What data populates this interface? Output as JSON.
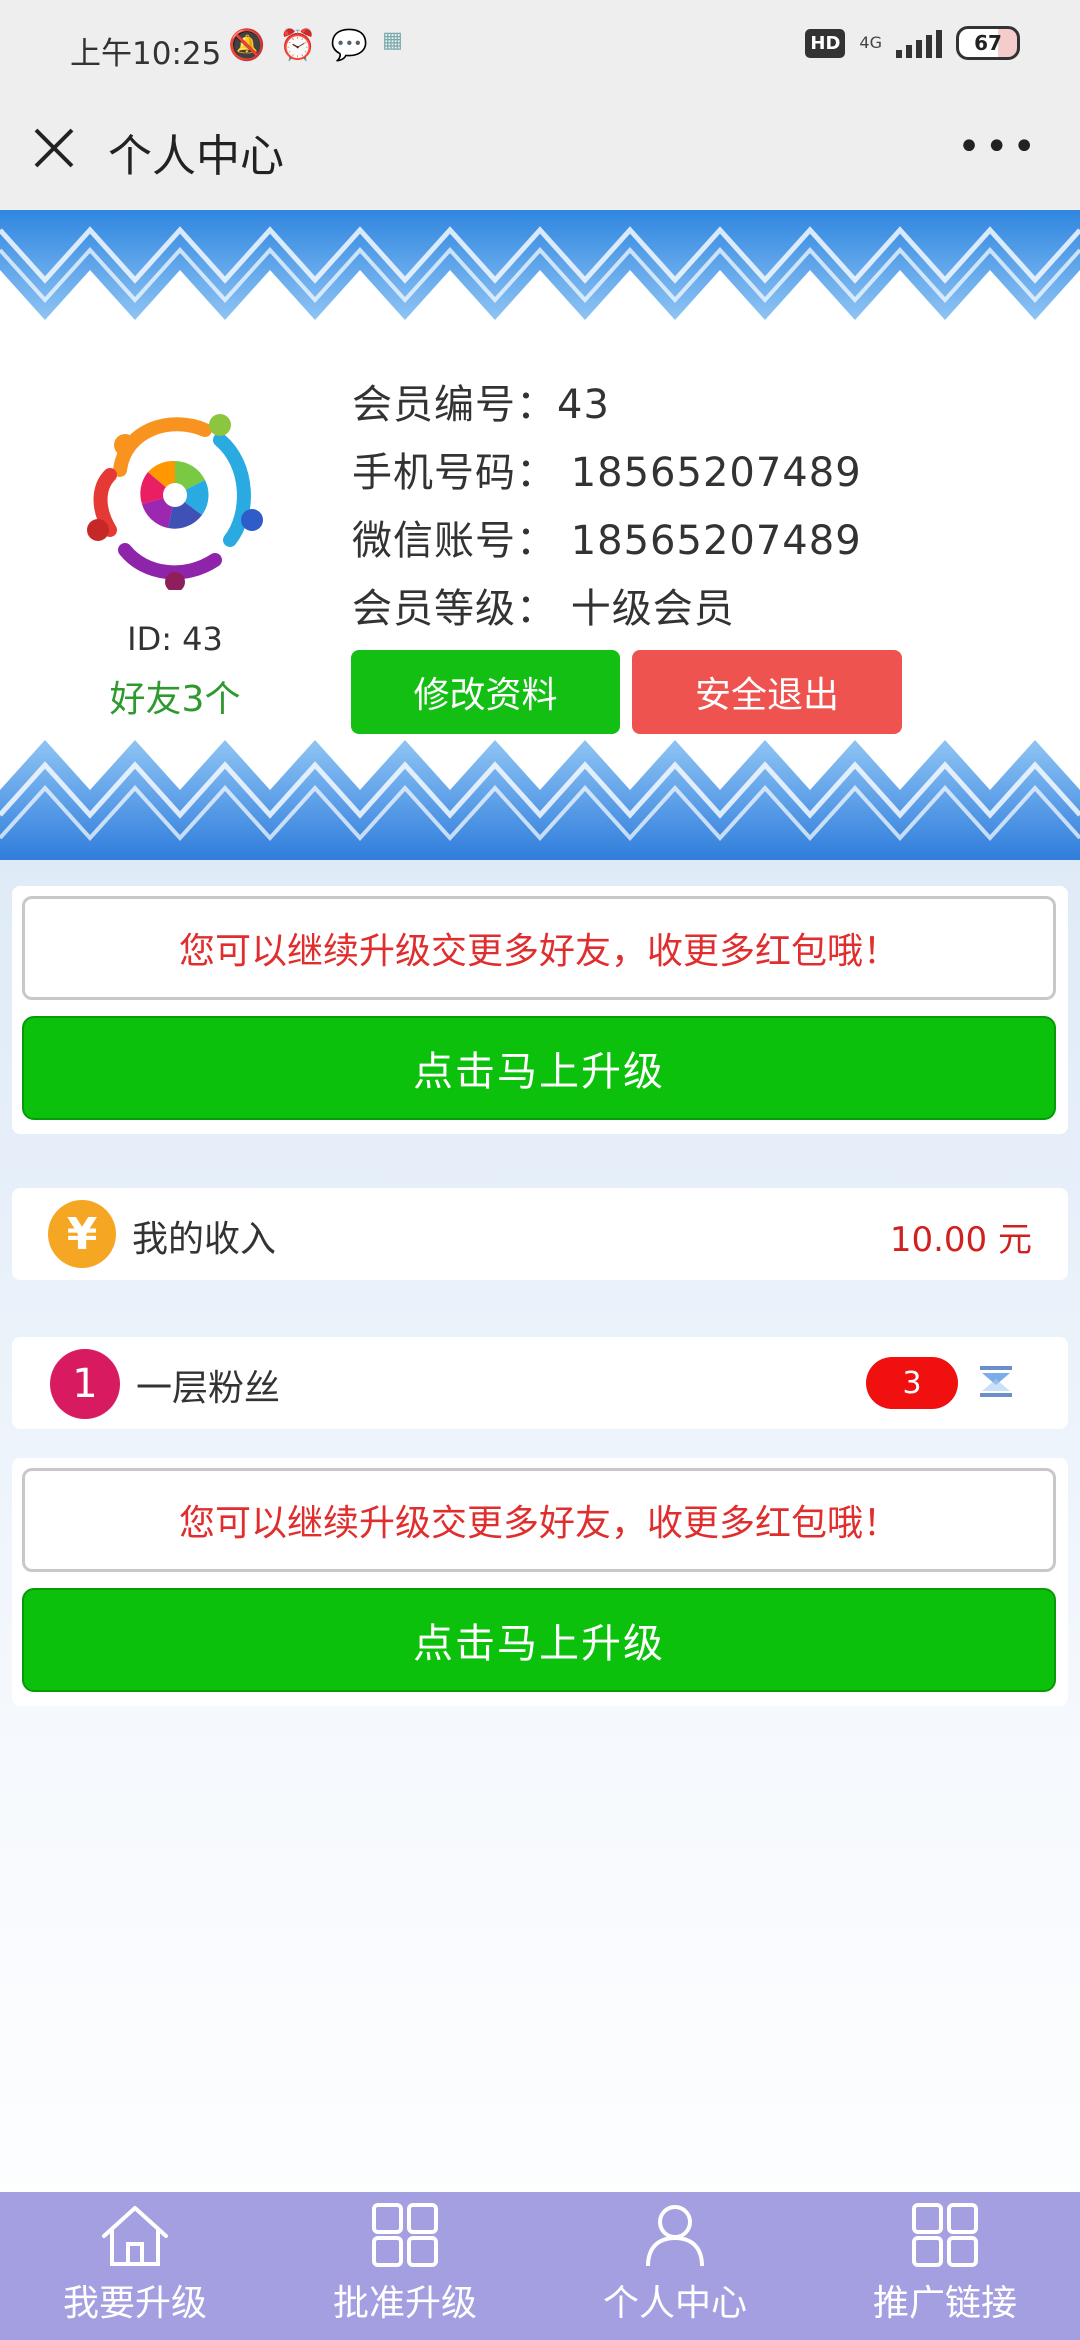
{
  "status_bar": {
    "time": "上午10:25",
    "icons": [
      "mute-alarm-icon",
      "alarm-clock-icon",
      "wechat-icon",
      "app-notification-icon"
    ],
    "hd_label": "HD",
    "network_label": "4G",
    "battery": "67"
  },
  "title_bar": {
    "title": "个人中心",
    "more_label": "•••"
  },
  "profile": {
    "id_text": "ID: 43",
    "friends_text": "好友3个",
    "member_no": "会员编号：43",
    "phone": "手机号码：  18565207489",
    "wechat": "微信账号：  18565207489",
    "level": "会员等级：  十级会员",
    "edit_button": "修改资料",
    "logout_button": "安全退出"
  },
  "upgrade_card_1": {
    "notice": "您可以继续升级交更多好友，收更多红包哦！",
    "button": "点击马上升级"
  },
  "income": {
    "icon_label": "¥",
    "label": "我的收入",
    "value": "10.00 元"
  },
  "fans": {
    "level_number": "1",
    "label": "一层粉丝",
    "count": "3"
  },
  "upgrade_card_2": {
    "notice": "您可以继续升级交更多好友，收更多红包哦！",
    "button": "点击马上升级"
  },
  "bottom_nav": {
    "items": [
      {
        "label": "我要升级",
        "icon": "home-icon"
      },
      {
        "label": "批准升级",
        "icon": "grid-icon"
      },
      {
        "label": "个人中心",
        "icon": "user-icon"
      },
      {
        "label": "推广链接",
        "icon": "grid-icon"
      }
    ]
  },
  "colors": {
    "accent_green": "#0bc10b",
    "logout_red": "#ef5350",
    "nav_purple": "#a49fe0",
    "text_red": "#e02d2d"
  }
}
